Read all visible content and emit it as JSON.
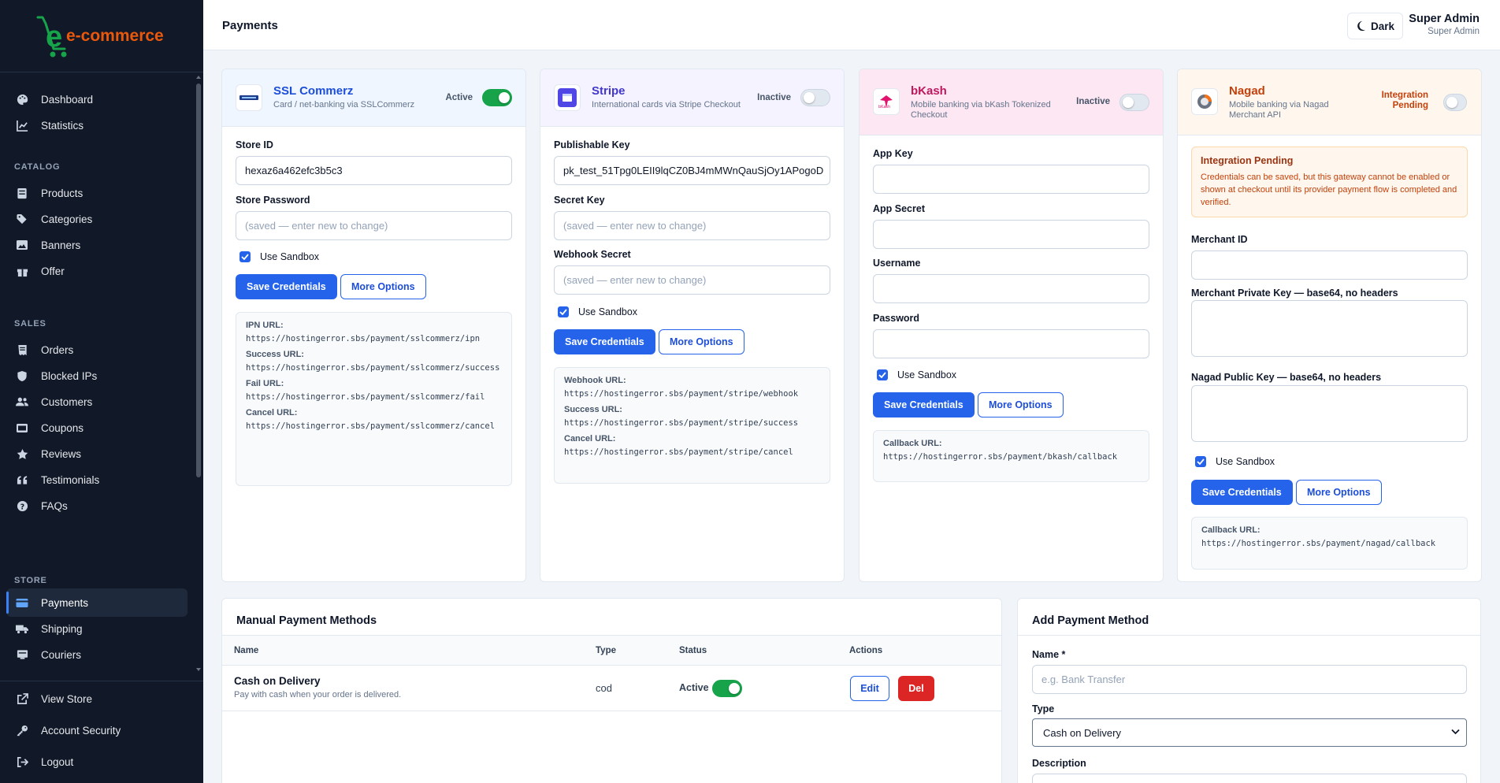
{
  "brand": {
    "logo_text": "e-commerce",
    "logo_color": "#ea580c",
    "logo_green": "#16a34a"
  },
  "sidebar": {
    "top_items": [
      {
        "label": "Dashboard",
        "icon": "palette-icon"
      },
      {
        "label": "Statistics",
        "icon": "chart-line-icon"
      }
    ],
    "sections": [
      {
        "title": "CATALOG",
        "items": [
          {
            "label": "Products",
            "icon": "box-icon"
          },
          {
            "label": "Categories",
            "icon": "tags-icon"
          },
          {
            "label": "Banners",
            "icon": "image-icon"
          },
          {
            "label": "Offer",
            "icon": "gift-icon"
          }
        ]
      },
      {
        "title": "SALES",
        "items": [
          {
            "label": "Orders",
            "icon": "receipt-icon"
          },
          {
            "label": "Blocked IPs",
            "icon": "shield-icon"
          },
          {
            "label": "Customers",
            "icon": "users-icon"
          },
          {
            "label": "Coupons",
            "icon": "ticket-icon"
          },
          {
            "label": "Reviews",
            "icon": "star-icon"
          },
          {
            "label": "Testimonials",
            "icon": "quote-icon"
          },
          {
            "label": "FAQs",
            "icon": "question-icon"
          }
        ]
      },
      {
        "title": "STORE",
        "items": [
          {
            "label": "Payments",
            "icon": "credit-card-icon",
            "active": true
          },
          {
            "label": "Shipping",
            "icon": "truck-icon"
          },
          {
            "label": "Couriers",
            "icon": "courier-icon"
          }
        ]
      }
    ],
    "bottom_items": [
      {
        "label": "View Store",
        "icon": "external-link-icon"
      },
      {
        "label": "Account Security",
        "icon": "key-icon"
      },
      {
        "label": "Logout",
        "icon": "logout-icon"
      }
    ]
  },
  "header": {
    "title": "Payments",
    "theme_button": "Dark",
    "user_name": "Super Admin",
    "user_role": "Super Admin"
  },
  "gateways": {
    "ssl": {
      "name": "SSL Commerz",
      "subtitle": "Card / net-banking via SSLCommerz",
      "status": "Active",
      "enabled": true,
      "head_bg": "#eff6ff",
      "name_color": "#1d4ed8",
      "store_id_label": "Store ID",
      "store_id_value": "hexaz6a462efc3b5c3",
      "store_password_label": "Store Password",
      "store_password_placeholder": "(saved — enter new to change)",
      "sandbox_label": "Use Sandbox",
      "save_label": "Save Credentials",
      "more_label": "More Options",
      "urls": [
        {
          "label": "IPN URL:",
          "value": "https://hostingerror.sbs/payment/sslcommerz/ipn"
        },
        {
          "label": "Success URL:",
          "value": "https://hostingerror.sbs/payment/sslcommerz/success"
        },
        {
          "label": "Fail URL:",
          "value": "https://hostingerror.sbs/payment/sslcommerz/fail"
        },
        {
          "label": "Cancel URL:",
          "value": "https://hostingerror.sbs/payment/sslcommerz/cancel"
        }
      ]
    },
    "stripe": {
      "name": "Stripe",
      "subtitle": "International cards via Stripe Checkout",
      "status": "Inactive",
      "enabled": false,
      "head_bg": "#f5f3ff",
      "name_color": "#4338ca",
      "publishable_label": "Publishable Key",
      "publishable_value": "pk_test_51Tpg0LEII9lqCZ0BJ4mMWnQauSjOy1APogoD",
      "secret_label": "Secret Key",
      "secret_placeholder": "(saved — enter new to change)",
      "webhook_label": "Webhook Secret",
      "webhook_placeholder": "(saved — enter new to change)",
      "sandbox_label": "Use Sandbox",
      "save_label": "Save Credentials",
      "more_label": "More Options",
      "urls": [
        {
          "label": "Webhook URL:",
          "value": "https://hostingerror.sbs/payment/stripe/webhook"
        },
        {
          "label": "Success URL:",
          "value": "https://hostingerror.sbs/payment/stripe/success"
        },
        {
          "label": "Cancel URL:",
          "value": "https://hostingerror.sbs/payment/stripe/cancel"
        }
      ]
    },
    "bkash": {
      "name": "bKash",
      "subtitle": "Mobile banking via bKash Tokenized Checkout",
      "status": "Inactive",
      "enabled": false,
      "head_bg": "#fce7f3",
      "name_color": "#be185d",
      "app_key_label": "App Key",
      "app_secret_label": "App Secret",
      "username_label": "Username",
      "password_label": "Password",
      "sandbox_label": "Use Sandbox",
      "save_label": "Save Credentials",
      "more_label": "More Options",
      "urls": [
        {
          "label": "Callback URL:",
          "value": "https://hostingerror.sbs/payment/bkash/callback"
        }
      ]
    },
    "nagad": {
      "name": "Nagad",
      "subtitle": "Mobile banking via Nagad Merchant API",
      "status": "Integration Pending",
      "enabled": false,
      "head_bg": "#fff7ed",
      "name_color": "#c2410c",
      "warning_title": "Integration Pending",
      "warning_text": "Credentials can be saved, but this gateway cannot be enabled or shown at checkout until its provider payment flow is completed and verified.",
      "merchant_id_label": "Merchant ID",
      "private_key_label": "Merchant Private Key — base64, no headers",
      "public_key_label": "Nagad Public Key — base64, no headers",
      "sandbox_label": "Use Sandbox",
      "save_label": "Save Credentials",
      "more_label": "More Options",
      "urls": [
        {
          "label": "Callback URL:",
          "value": "https://hostingerror.sbs/payment/nagad/callback"
        }
      ]
    }
  },
  "manual": {
    "title": "Manual Payment Methods",
    "columns": [
      "Name",
      "Type",
      "Status",
      "Actions"
    ],
    "rows": [
      {
        "name": "Cash on Delivery",
        "description": "Pay with cash when your order is delivered.",
        "type": "cod",
        "status": "Active",
        "edit": "Edit",
        "delete": "Del"
      }
    ]
  },
  "add_method": {
    "title": "Add Payment Method",
    "name_label": "Name *",
    "name_placeholder": "e.g. Bank Transfer",
    "type_label": "Type",
    "type_value": "Cash on Delivery",
    "description_label": "Description"
  },
  "colors": {
    "primary": "#2563eb",
    "success": "#16a34a",
    "danger": "#dc2626",
    "sidebar": "#111827"
  }
}
